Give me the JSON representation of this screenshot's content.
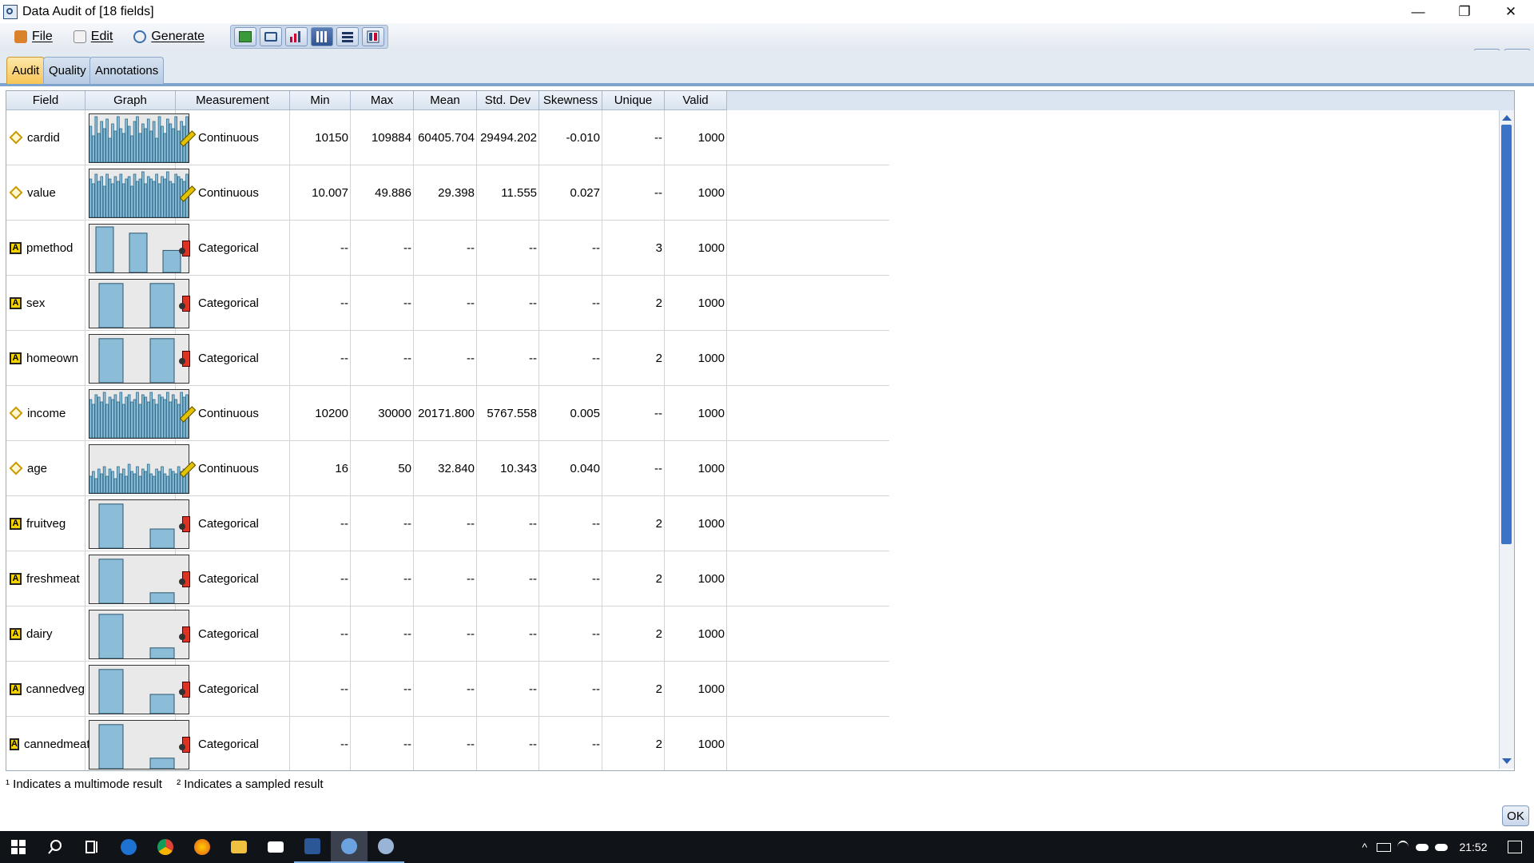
{
  "window": {
    "title": "Data Audit of [18 fields]",
    "controls": {
      "minimize": "—",
      "restore": "❐",
      "close": "✕"
    }
  },
  "menu": {
    "file": "File",
    "edit": "Edit",
    "generate": "Generate"
  },
  "toolbar_icons": [
    "export-icon",
    "print-icon",
    "chart-icon",
    "columns-view-icon",
    "list-view-icon",
    "table-view-icon"
  ],
  "tabs": [
    {
      "label": "Audit",
      "active": true
    },
    {
      "label": "Quality",
      "active": false
    },
    {
      "label": "Annotations",
      "active": false
    }
  ],
  "table": {
    "columns": [
      "Field",
      "Graph",
      "Measurement",
      "Min",
      "Max",
      "Mean",
      "Std. Dev",
      "Skewness",
      "Unique",
      "Valid"
    ],
    "rows": [
      {
        "field": "cardid",
        "type": "continuous",
        "measurement": "Continuous",
        "min": "10150",
        "max": "109884",
        "mean": "60405.704",
        "std": "29494.202",
        "skew": "-0.010",
        "unique": "--",
        "valid": "1000"
      },
      {
        "field": "value",
        "type": "continuous",
        "measurement": "Continuous",
        "min": "10.007",
        "max": "49.886",
        "mean": "29.398",
        "std": "11.555",
        "skew": "0.027",
        "unique": "--",
        "valid": "1000"
      },
      {
        "field": "pmethod",
        "type": "categorical",
        "measurement": "Categorical",
        "min": "--",
        "max": "--",
        "mean": "--",
        "std": "--",
        "skew": "--",
        "unique": "3",
        "valid": "1000"
      },
      {
        "field": "sex",
        "type": "categorical",
        "measurement": "Categorical",
        "min": "--",
        "max": "--",
        "mean": "--",
        "std": "--",
        "skew": "--",
        "unique": "2",
        "valid": "1000"
      },
      {
        "field": "homeown",
        "type": "categorical",
        "measurement": "Categorical",
        "min": "--",
        "max": "--",
        "mean": "--",
        "std": "--",
        "skew": "--",
        "unique": "2",
        "valid": "1000"
      },
      {
        "field": "income",
        "type": "continuous",
        "measurement": "Continuous",
        "min": "10200",
        "max": "30000",
        "mean": "20171.800",
        "std": "5767.558",
        "skew": "0.005",
        "unique": "--",
        "valid": "1000"
      },
      {
        "field": "age",
        "type": "continuous",
        "measurement": "Continuous",
        "min": "16",
        "max": "50",
        "mean": "32.840",
        "std": "10.343",
        "skew": "0.040",
        "unique": "--",
        "valid": "1000"
      },
      {
        "field": "fruitveg",
        "type": "categorical",
        "measurement": "Categorical",
        "min": "--",
        "max": "--",
        "mean": "--",
        "std": "--",
        "skew": "--",
        "unique": "2",
        "valid": "1000"
      },
      {
        "field": "freshmeat",
        "type": "categorical",
        "measurement": "Categorical",
        "min": "--",
        "max": "--",
        "mean": "--",
        "std": "--",
        "skew": "--",
        "unique": "2",
        "valid": "1000"
      },
      {
        "field": "dairy",
        "type": "categorical",
        "measurement": "Categorical",
        "min": "--",
        "max": "--",
        "mean": "--",
        "std": "--",
        "skew": "--",
        "unique": "2",
        "valid": "1000"
      },
      {
        "field": "cannedveg",
        "type": "categorical",
        "measurement": "Categorical",
        "min": "--",
        "max": "--",
        "mean": "--",
        "std": "--",
        "skew": "--",
        "unique": "2",
        "valid": "1000"
      },
      {
        "field": "cannedmeat",
        "type": "categorical",
        "measurement": "Categorical",
        "min": "--",
        "max": "--",
        "mean": "--",
        "std": "--",
        "skew": "--",
        "unique": "2",
        "valid": "1000"
      }
    ]
  },
  "graph_bars": {
    "cardid": [
      0.75,
      0.55,
      0.95,
      0.6,
      0.85,
      0.7,
      0.9,
      0.5,
      0.8,
      0.65,
      0.95,
      0.7,
      0.6,
      0.9,
      0.75,
      0.55,
      0.85,
      0.95,
      0.6,
      0.8,
      0.7,
      0.9,
      0.65,
      0.85,
      0.5,
      0.95,
      0.75,
      0.6,
      0.9,
      0.8,
      0.7,
      0.95,
      0.65,
      0.85,
      0.75,
      0.95
    ],
    "value": [
      0.8,
      0.7,
      0.9,
      0.75,
      0.85,
      0.65,
      0.9,
      0.8,
      0.7,
      0.85,
      0.75,
      0.9,
      0.7,
      0.8,
      0.85,
      0.65,
      0.9,
      0.75,
      0.8,
      0.95,
      0.7,
      0.85,
      0.8,
      0.75,
      0.9,
      0.7,
      0.85,
      0.8,
      0.95,
      0.75,
      0.7,
      0.9,
      0.85,
      0.8,
      0.75,
      0.9
    ],
    "pmethod": [
      0.95,
      0.82,
      0.46
    ],
    "sex": [
      0.92,
      0.92
    ],
    "homeown": [
      0.92,
      0.92
    ],
    "income": [
      0.8,
      0.7,
      0.9,
      0.85,
      0.75,
      0.95,
      0.7,
      0.85,
      0.8,
      0.9,
      0.75,
      0.95,
      0.7,
      0.85,
      0.9,
      0.75,
      0.8,
      0.95,
      0.7,
      0.9,
      0.85,
      0.75,
      0.95,
      0.8,
      0.7,
      0.9,
      0.85,
      0.8,
      0.95,
      0.75,
      0.9,
      0.8,
      0.7,
      0.95,
      0.85,
      0.9
    ],
    "age": [
      0.35,
      0.45,
      0.3,
      0.5,
      0.4,
      0.55,
      0.35,
      0.5,
      0.45,
      0.3,
      0.55,
      0.4,
      0.5,
      0.35,
      0.6,
      0.45,
      0.4,
      0.55,
      0.35,
      0.5,
      0.45,
      0.6,
      0.4,
      0.35,
      0.5,
      0.45,
      0.55,
      0.4,
      0.35,
      0.5,
      0.45,
      0.4,
      0.55,
      0.45,
      0.5,
      0.4
    ],
    "fruitveg": [
      0.92,
      0.4
    ],
    "freshmeat": [
      0.92,
      0.22
    ],
    "dairy": [
      0.92,
      0.22
    ],
    "cannedveg": [
      0.92,
      0.4
    ],
    "cannedmeat": [
      0.92,
      0.22
    ]
  },
  "footer": {
    "multimode_note": "¹ Indicates a multimode result",
    "sampled_note": "² Indicates a sampled result",
    "ok": "OK"
  },
  "taskbar": {
    "time": "21:52",
    "apps": [
      "windows-start-icon",
      "search-icon",
      "task-view-icon",
      "edge-icon",
      "chrome-icon",
      "firefox-icon",
      "file-explorer-icon",
      "mail-icon",
      "word-icon",
      "modeler-icon",
      "modeler-alt-icon"
    ]
  },
  "colors": {
    "bar_fill": "#8bbcd8",
    "bar_dense": "#2f6d8a",
    "accent": "#3a73c8",
    "active_tab": "#f8c457"
  }
}
